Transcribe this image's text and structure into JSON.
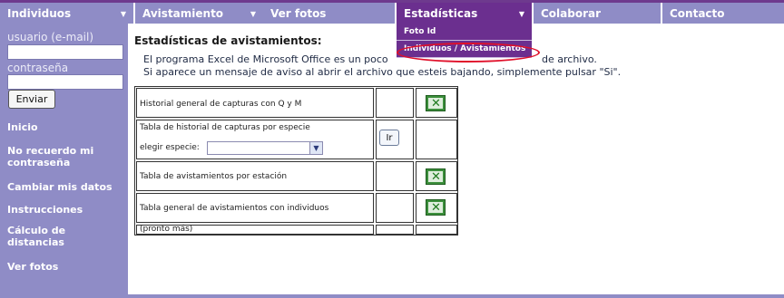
{
  "nav": {
    "items": [
      {
        "label": "Individuos",
        "has_caret": true
      },
      {
        "label": "Avistamiento",
        "has_caret": true
      },
      {
        "label": "Ver fotos",
        "has_caret": false
      },
      {
        "label": "Estadísticas",
        "has_caret": true
      },
      {
        "label": "Colaborar",
        "has_caret": false
      },
      {
        "label": "Contacto",
        "has_caret": false
      }
    ],
    "dropdown": [
      "Foto Id",
      "Individuos / Avistamientos"
    ]
  },
  "login": {
    "user_label": "usuario (e-mail)",
    "pass_label": "contraseña",
    "send_label": "Enviar"
  },
  "sidebar": {
    "links": [
      "Inicio",
      "No recuerdo mi contraseña",
      "Cambiar mis datos",
      "Instrucciones",
      "Cálculo de distancias",
      "Ver fotos"
    ]
  },
  "main": {
    "title": "Estadísticas de avistamientos:",
    "info_line1": "El programa Excel de Microsoft Office es un poco",
    "info_line1_end": "de archivo.",
    "info_line2": "Si aparece un mensaje de aviso al abrir el archivo que esteis bajando, simplemente pulsar \"Si\"."
  },
  "table": {
    "rows": [
      {
        "label": "Historial general de capturas con Q y M",
        "action": "excel"
      },
      {
        "label": "Tabla de historial de capturas por especie",
        "select_label": "elegir especie:",
        "action": "ir"
      },
      {
        "label": "Tabla de avistamientos por estación",
        "action": "excel"
      },
      {
        "label": "Tabla general de avistamientos con individuos",
        "action": "excel"
      },
      {
        "label": "(pronto más)",
        "action": "none"
      }
    ],
    "ir_label": "Ir"
  },
  "colors": {
    "nav_bg": "#8f8cc6",
    "nav_active": "#6b2f8f",
    "highlight_ring": "#e0102a"
  }
}
